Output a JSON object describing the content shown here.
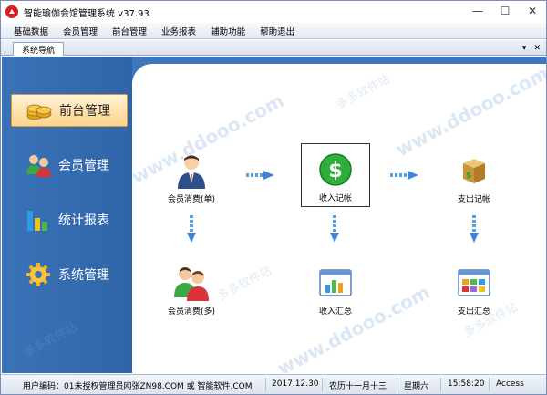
{
  "window": {
    "title": "智能瑜伽会馆管理系统 v37.93",
    "minimize": "—",
    "maximize": "☐",
    "close": "✕"
  },
  "menu": [
    "基础数据",
    "会员管理",
    "前台管理",
    "业务报表",
    "辅助功能",
    "帮助退出"
  ],
  "tab": {
    "label": "系统导航",
    "dropdown": "▾",
    "close": "✕"
  },
  "sidebar": {
    "items": [
      {
        "label": "前台管理",
        "icon": "coins-icon",
        "active": true
      },
      {
        "label": "会员管理",
        "icon": "members-icon",
        "active": false
      },
      {
        "label": "统计报表",
        "icon": "bar-chart-icon",
        "active": false
      },
      {
        "label": "系统管理",
        "icon": "gear-icon",
        "active": false
      }
    ]
  },
  "nodes": {
    "member_single": "会员消费(单)",
    "income_record": "收入记帐",
    "expense_record": "支出记帐",
    "member_multi": "会员消费(多)",
    "income_summary": "收入汇总",
    "expense_summary": "支出汇总"
  },
  "watermarks": {
    "text1": "www.ddooo.com",
    "text2": "多多软件站"
  },
  "status": {
    "user": "用户编码：01未授权管理员网张ZN98.COM 或 智能软件.COM",
    "date": "2017.12.30",
    "lunar": "农历十一月十三",
    "weekday": "星期六",
    "time": "15:58:20",
    "db": "Access"
  },
  "colors": {
    "accent": "#3d76bd",
    "active_item": "#ffd48a",
    "brand_red": "#d81e1e"
  }
}
